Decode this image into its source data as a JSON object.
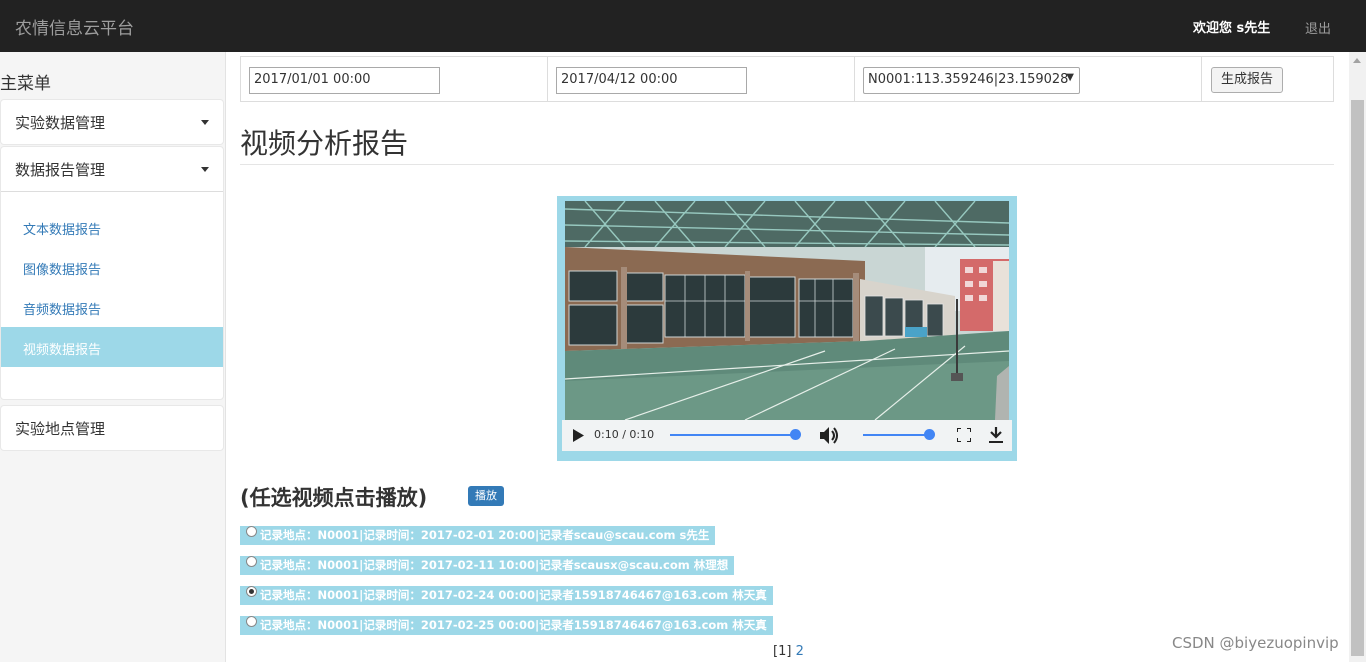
{
  "header": {
    "brand": "农情信息云平台",
    "welcome": "欢迎您 s先生",
    "logout": "退出"
  },
  "sidebar": {
    "title": "主菜单",
    "groups": [
      {
        "label": "实验数据管理"
      },
      {
        "label": "数据报告管理"
      },
      {
        "label": "实验地点管理"
      }
    ],
    "report_items": [
      {
        "label": "文本数据报告"
      },
      {
        "label": "图像数据报告"
      },
      {
        "label": "音频数据报告"
      },
      {
        "label": "视频数据报告",
        "active": true
      }
    ]
  },
  "form": {
    "start_time": "2017/01/01  00:00",
    "end_time": "2017/04/12  00:00",
    "location": "N0001:113.359246|23.159028",
    "generate_button": "生成报告"
  },
  "report": {
    "title": "视频分析报告",
    "video": {
      "time": "0:10 / 0:10",
      "progress": 1.0,
      "volume": 1.0
    },
    "select_heading": "(任选视频点击播放)",
    "play_button": "播放",
    "records": [
      {
        "text": "记录地点：N0001|记录时间：2017-02-01 20:00|记录者scau@scau.com s先生",
        "checked": false
      },
      {
        "text": "记录地点：N0001|记录时间：2017-02-11 10:00|记录者scausx@scau.com 林理想",
        "checked": false
      },
      {
        "text": "记录地点：N0001|记录时间：2017-02-24 00:00|记录者15918746467@163.com 林天真",
        "checked": true
      },
      {
        "text": "记录地点：N0001|记录时间：2017-02-25 00:00|记录者15918746467@163.com 林天真",
        "checked": false
      }
    ],
    "pager": {
      "current": "[1]",
      "next": "2"
    }
  },
  "watermark": "CSDN @biyezuopinvip",
  "colors": {
    "navbar_bg": "#222222",
    "accent_light_blue": "#9dd8e8",
    "link_blue": "#337ab7",
    "media_blue": "#4285f4"
  }
}
